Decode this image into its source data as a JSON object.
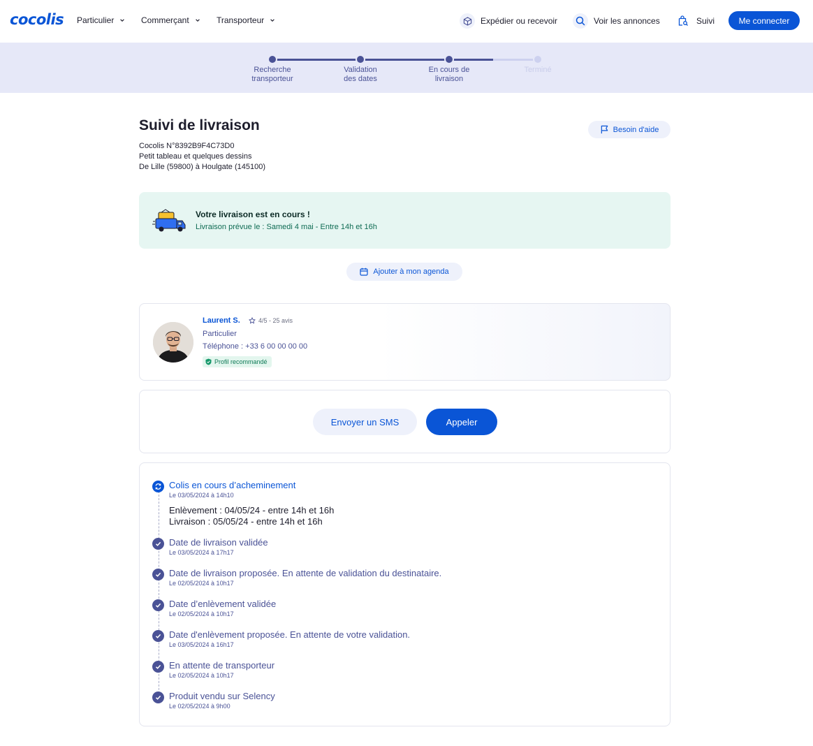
{
  "header": {
    "logo": "cocolis",
    "nav": [
      {
        "label": "Particulier"
      },
      {
        "label": "Commerçant"
      },
      {
        "label": "Transporteur"
      }
    ],
    "links": {
      "ship": "Expédier ou recevoir",
      "listings": "Voir les annonces",
      "tracking": "Suivi"
    },
    "connect_label": "Me connecter"
  },
  "stepper": {
    "steps": [
      {
        "label": "Recherche\ntransporteur",
        "state": "done"
      },
      {
        "label": "Validation\ndes dates",
        "state": "done"
      },
      {
        "label": "En cours de\nlivraison",
        "state": "done"
      },
      {
        "label": "Terminé",
        "state": "todo"
      }
    ]
  },
  "delivery": {
    "title": "Suivi de livraison",
    "reference": "Cocolis N°8392B9F4C73D0",
    "description": "Petit tableau et quelques dessins",
    "route": "De Lille (59800) à Houlgate (145100)",
    "help_label": "Besoin d'aide"
  },
  "banner": {
    "title": "Votre livraison est en cours !",
    "subtitle": "Livraison prévue le : Samedi 4 mai - Entre 14h et 16h"
  },
  "agenda_label": "Ajouter à mon agenda",
  "carrier": {
    "name": "Laurent S.",
    "rating": "4/5 - 25 avis",
    "type": "Particulier",
    "phone": "Téléphone : +33 6 00 00 00 00",
    "badge": "Profil recommandé"
  },
  "actions": {
    "sms_label": "Envoyer un SMS",
    "call_label": "Appeler"
  },
  "timeline": [
    {
      "title": "Colis en cours d’acheminement",
      "date": "Le 03/05/2024 à 14h10",
      "state": "active",
      "details": [
        "Enlèvement : 04/05/24 - entre 14h et 16h",
        "Livraison : 05/05/24 - entre 14h et 16h"
      ]
    },
    {
      "title": "Date de livraison validée",
      "date": "Le 03/05/2024 à 17h17",
      "state": "done"
    },
    {
      "title": "Date de livraison proposée. En attente de validation du destinataire.",
      "date": "Le 02/05/2024 à 10h17",
      "state": "done"
    },
    {
      "title": "Date d’enlèvement validée",
      "date": "Le 02/05/2024 à 10h17",
      "state": "done"
    },
    {
      "title": "Date d'enlèvement proposée. En attente de votre validation.",
      "date": "Le 03/05/2024 à 16h17",
      "state": "done"
    },
    {
      "title": "En attente de transporteur",
      "date": "Le 02/05/2024 à 10h17",
      "state": "done"
    },
    {
      "title": "Produit vendu sur Selency",
      "date": "Le 02/05/2024 à 9h00",
      "state": "done"
    }
  ],
  "colors": {
    "brand": "#0a55d6",
    "indigo": "#4a5296",
    "stepper_bg": "#e6e8f8",
    "banner_bg": "#e6f6f2",
    "badge_green": "#0e7a56"
  }
}
